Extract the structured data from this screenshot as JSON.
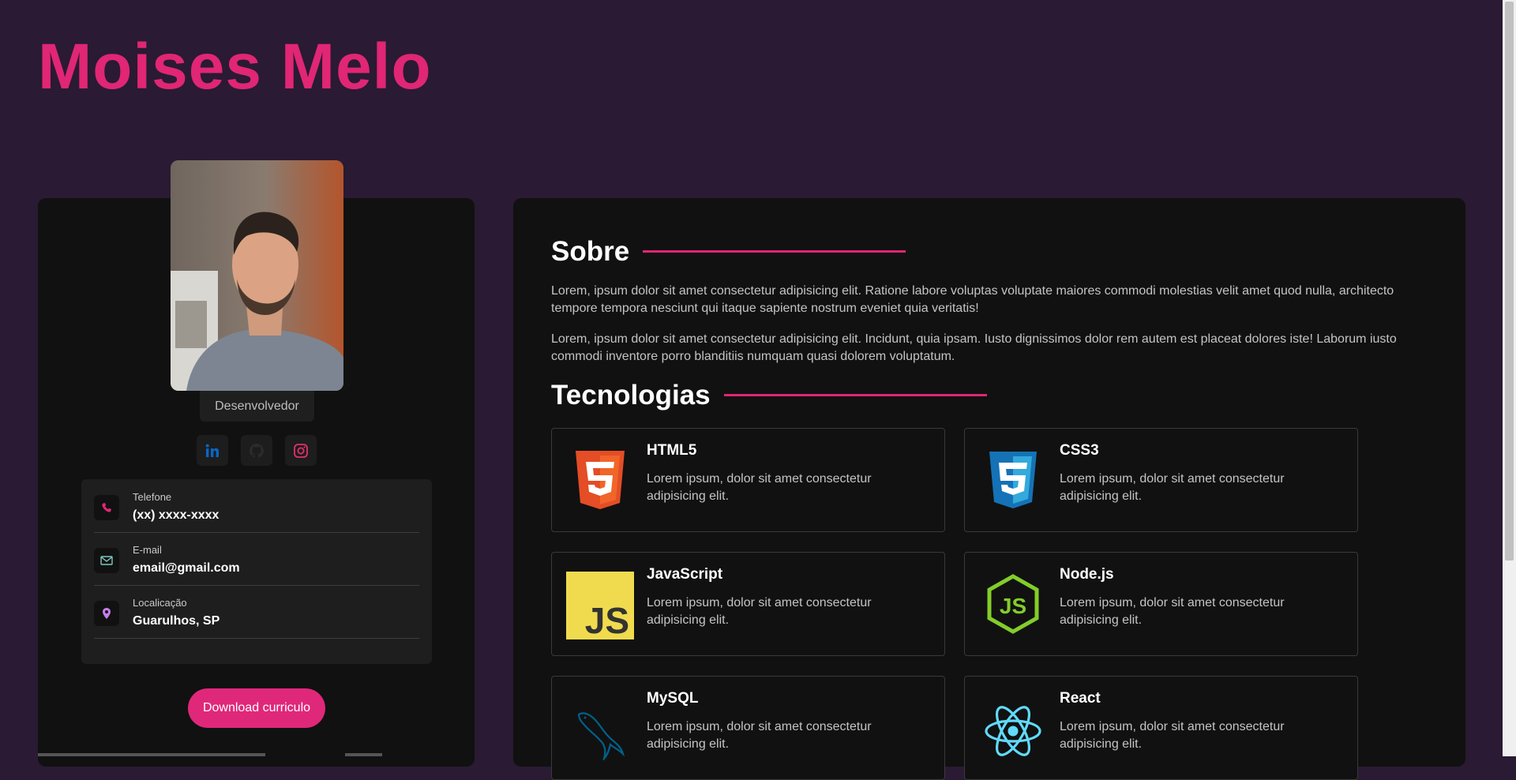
{
  "header": {
    "name": "Moises Melo"
  },
  "profile": {
    "role": "Desenvolvedor",
    "socials": [
      {
        "icon": "linkedin-icon",
        "color": "#0a66c2"
      },
      {
        "icon": "github-icon",
        "color": "#2b2b2b"
      },
      {
        "icon": "instagram-icon",
        "color": "#e1306c"
      }
    ],
    "contacts": [
      {
        "label": "Telefone",
        "value": "(xx) xxxx-xxxx",
        "icon": "phone-icon",
        "color": "#e02674"
      },
      {
        "label": "E-mail",
        "value": "email@gmail.com",
        "icon": "mail-icon",
        "color": "#7fc7c0"
      },
      {
        "label": "Localicação",
        "value": "Guarulhos, SP",
        "icon": "location-icon",
        "color": "#c77dea"
      }
    ],
    "download_label": "Download curriculo"
  },
  "about": {
    "title": "Sobre",
    "paragraphs": [
      "Lorem, ipsum dolor sit amet consectetur adipisicing elit. Ratione labore voluptas voluptate maiores commodi molestias velit amet quod nulla, architecto tempore tempora nesciunt qui itaque sapiente nostrum eveniet quia veritatis!",
      "Lorem, ipsum dolor sit amet consectetur adipisicing elit. Incidunt, quia ipsam. Iusto dignissimos dolor rem autem est placeat dolores iste! Laborum iusto commodi inventore porro blanditiis numquam quasi dolorem voluptatum."
    ]
  },
  "tech": {
    "title": "Tecnologias",
    "items": [
      {
        "name": "HTML5",
        "desc": "Lorem ipsum, dolor sit amet consectetur adipisicing elit.",
        "icon": "html5-icon",
        "color": "#e44d26"
      },
      {
        "name": "CSS3",
        "desc": "Lorem ipsum, dolor sit amet consectetur adipisicing elit.",
        "icon": "css3-icon",
        "color": "#1572b6"
      },
      {
        "name": "JavaScript",
        "desc": "Lorem ipsum, dolor sit amet consectetur adipisicing elit.",
        "icon": "javascript-icon",
        "color": "#f0db4f"
      },
      {
        "name": "Node.js",
        "desc": "Lorem ipsum, dolor sit amet consectetur adipisicing elit.",
        "icon": "nodejs-icon",
        "color": "#83cd29"
      },
      {
        "name": "MySQL",
        "desc": "Lorem ipsum, dolor sit amet consectetur adipisicing elit.",
        "icon": "mysql-icon",
        "color": "#00618a"
      },
      {
        "name": "React",
        "desc": "Lorem ipsum, dolor sit amet consectetur adipisicing elit.",
        "icon": "react-icon",
        "color": "#61dafb"
      }
    ]
  },
  "colors": {
    "accent": "#e02674",
    "background": "#2a1a33",
    "card": "#111111"
  }
}
